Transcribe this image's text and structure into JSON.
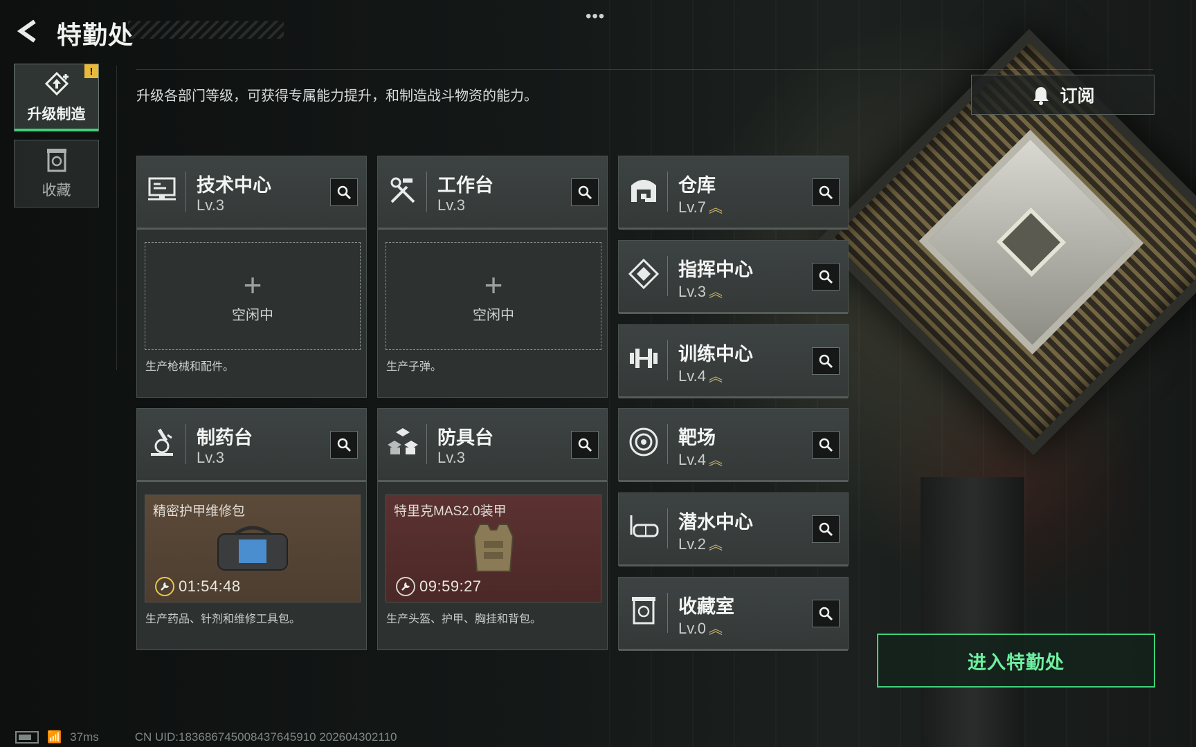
{
  "header": {
    "title": "特勤处",
    "more": "•••"
  },
  "sidebar": {
    "items": [
      {
        "label": "升级制造",
        "badge": "!",
        "icon": "upgrade-icon"
      },
      {
        "label": "收藏",
        "icon": "collection-icon"
      }
    ]
  },
  "description": "升级各部门等级，可获得专属能力提升，和制造战斗物资的能力。",
  "subscribe": {
    "label": "订阅",
    "icon": "bell-icon"
  },
  "facilities": [
    {
      "name": "技术中心",
      "level": "Lv.3",
      "icon": "computer-icon",
      "slot": {
        "status": "idle",
        "text": "空闲中"
      },
      "desc": "生产枪械和配件。"
    },
    {
      "name": "工作台",
      "level": "Lv.3",
      "icon": "tools-icon",
      "slot": {
        "status": "idle",
        "text": "空闲中"
      },
      "desc": "生产子弹。"
    },
    {
      "name": "制药台",
      "level": "Lv.3",
      "icon": "microscope-icon",
      "slot": {
        "status": "producing",
        "item": "精密护甲维修包",
        "timer": "01:54:48",
        "color": "#5c4a39"
      },
      "desc": "生产药品、针剂和维修工具包。"
    },
    {
      "name": "防具台",
      "level": "Lv.3",
      "icon": "blocks-icon",
      "slot": {
        "status": "producing",
        "item": "特里克MAS2.0装甲",
        "timer": "09:59:27",
        "color": "#5b3231"
      },
      "desc": "生产头盔、护甲、胸挂和背包。"
    }
  ],
  "facilities_right": [
    {
      "name": "仓库",
      "level": "Lv.7",
      "icon": "warehouse-icon"
    },
    {
      "name": "指挥中心",
      "level": "Lv.3",
      "icon": "command-icon"
    },
    {
      "name": "训练中心",
      "level": "Lv.4",
      "icon": "dumbbell-icon"
    },
    {
      "name": "靶场",
      "level": "Lv.4",
      "icon": "target-icon"
    },
    {
      "name": "潜水中心",
      "level": "Lv.2",
      "icon": "diving-mask-icon"
    },
    {
      "name": "收藏室",
      "level": "Lv.0",
      "icon": "collection-room-icon"
    }
  ],
  "enter_button": "进入特勤处",
  "status": {
    "ping": "37ms",
    "uid": "CN UID:18368674500843764591​0 202604302110"
  },
  "colors": {
    "accent": "#3fd27a",
    "warning": "#e8b93a",
    "level_arrow": "#c9b36a"
  }
}
